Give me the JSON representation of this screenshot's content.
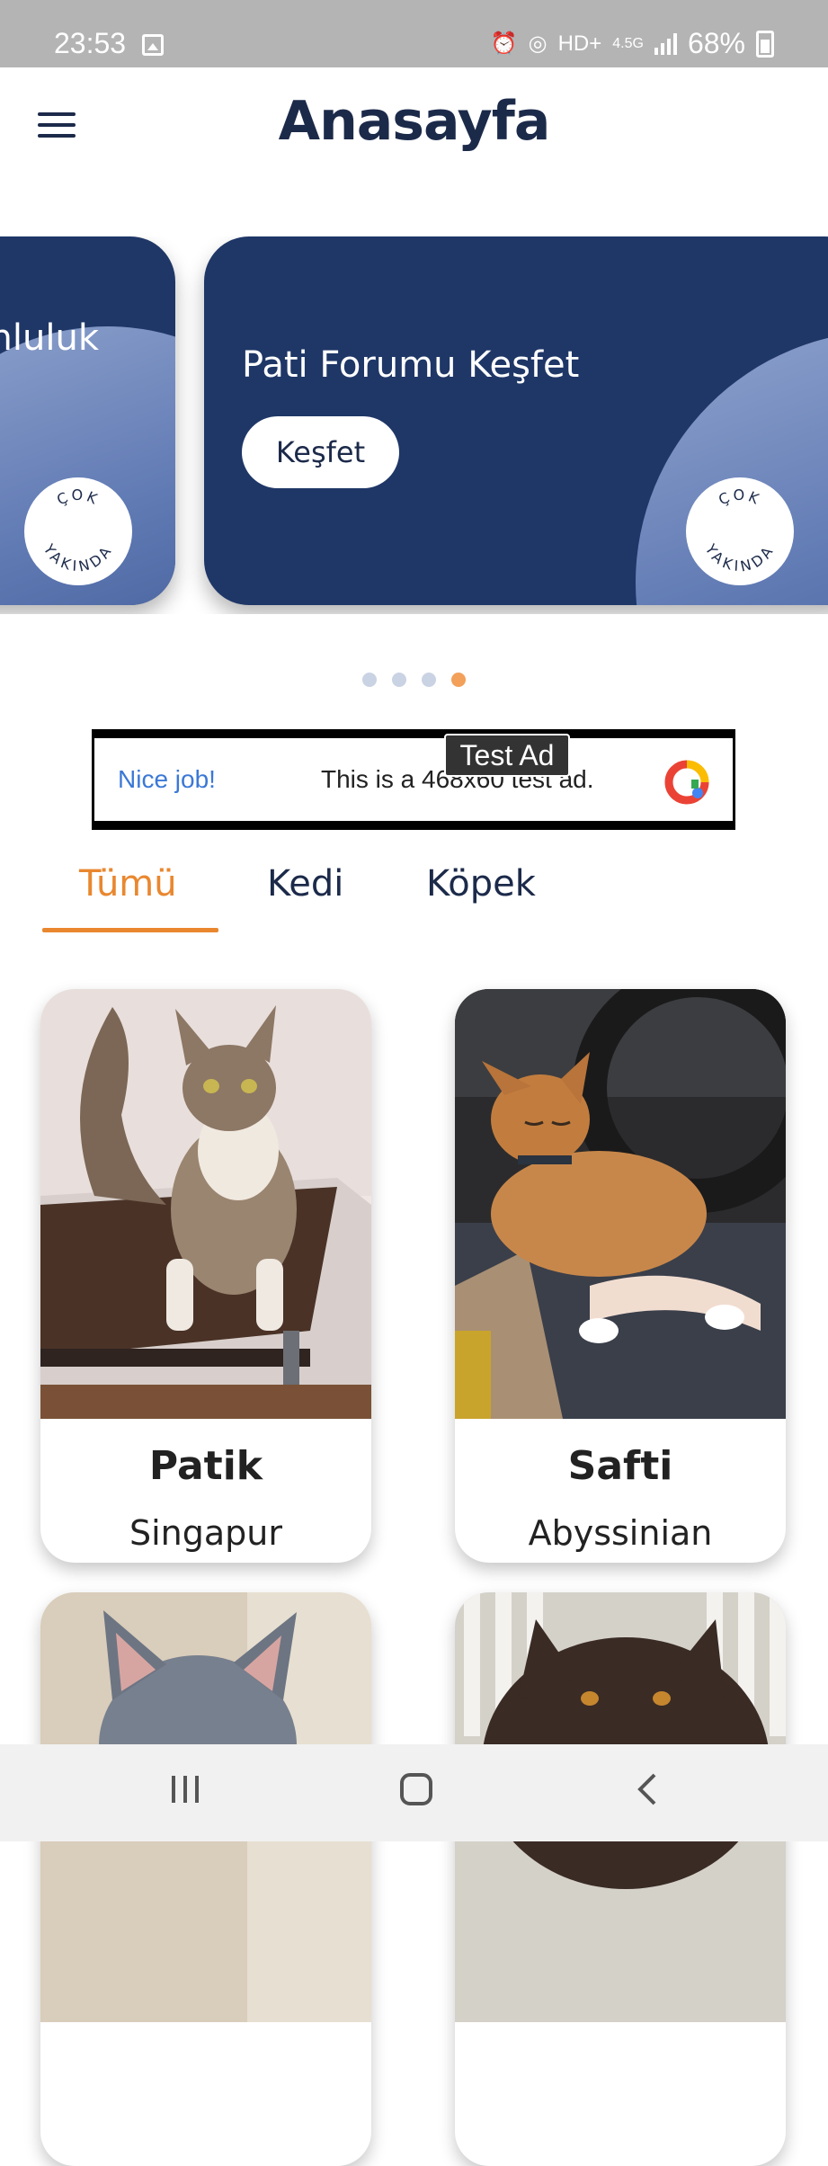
{
  "status_bar": {
    "time": "23:53",
    "extra": "HD+",
    "network": "4.5G",
    "battery": "68%"
  },
  "app_bar": {
    "title": "Anasayfa",
    "menu_icon": "menu-icon"
  },
  "carousel": {
    "cards": [
      {
        "title": "nluluk",
        "badge_top": "ÇOK",
        "badge_bottom": "YAKINDA"
      },
      {
        "title": "Pati Forumu Keşfet",
        "button": "Keşfet",
        "badge_top": "ÇOK",
        "badge_bottom": "YAKINDA"
      }
    ],
    "page_count": 4,
    "active_page": 4
  },
  "ad": {
    "label": "Test Ad",
    "left_text": "Nice job!",
    "body": "This is a 468x60 test ad."
  },
  "tabs": [
    {
      "label": "Tümü",
      "active": true
    },
    {
      "label": "Kedi",
      "active": false
    },
    {
      "label": "Köpek",
      "active": false
    }
  ],
  "pets": [
    {
      "name": "Patik",
      "breed": "Singapur"
    },
    {
      "name": "Safti",
      "breed": "Abyssinian"
    },
    {
      "name": "",
      "breed": ""
    },
    {
      "name": "",
      "breed": ""
    }
  ],
  "colors": {
    "primary": "#1f3767",
    "accent": "#e9872f",
    "text": "#1c2a4a"
  }
}
